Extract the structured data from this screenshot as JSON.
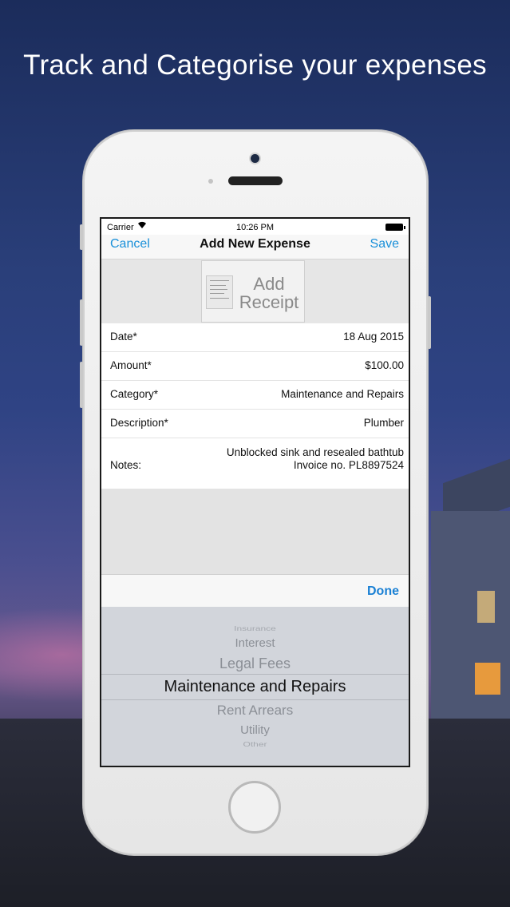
{
  "headline": "Track and Categorise your expenses",
  "status_bar": {
    "carrier": "Carrier",
    "time": "10:26 PM"
  },
  "nav": {
    "cancel": "Cancel",
    "title": "Add New Expense",
    "save": "Save"
  },
  "receipt": {
    "label_line1": "Add",
    "label_line2": "Receipt"
  },
  "form": {
    "date": {
      "label": "Date*",
      "value": "18 Aug 2015"
    },
    "amount": {
      "label": "Amount*",
      "value": "$100.00"
    },
    "category": {
      "label": "Category*",
      "value": "Maintenance and Repairs"
    },
    "description": {
      "label": "Description*",
      "value": "Plumber"
    },
    "notes": {
      "label": "Notes:",
      "value_line1": "Unblocked sink and resealed bathtub",
      "value_line2": "Invoice no. PL8897524"
    }
  },
  "toolbar": {
    "done": "Done"
  },
  "picker": {
    "items": [
      "Insurance",
      "Interest",
      "Legal Fees",
      "Maintenance and Repairs",
      "Rent Arrears",
      "Utility",
      "Other"
    ],
    "selected": "Maintenance and Repairs"
  },
  "colors": {
    "accent": "#1a90d9",
    "done": "#1a80d4"
  }
}
